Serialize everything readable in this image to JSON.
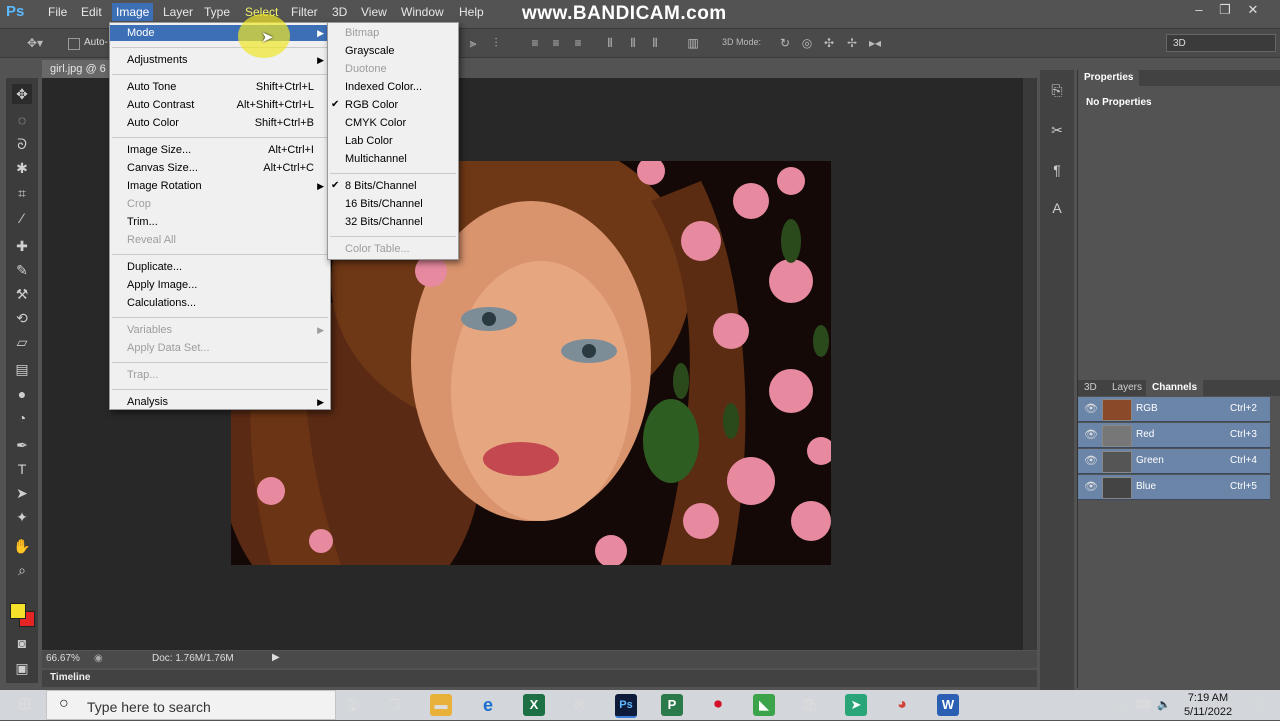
{
  "app": {
    "logo": "Ps",
    "menus": [
      "File",
      "Edit",
      "Image",
      "Layer",
      "Type",
      "Select",
      "Filter",
      "3D",
      "View",
      "Window",
      "Help"
    ],
    "watermark": "www.BANDICAM.com",
    "window_buttons": [
      "–",
      "❐",
      "✕"
    ]
  },
  "options_bar": {
    "auto_select_label": "Auto-",
    "three_d_mode_label": "3D Mode:",
    "workspace_select": "3D"
  },
  "document": {
    "tab_title": "girl.jpg @ 6",
    "zoom": "66.67%",
    "doc_info": "Doc: 1.76M/1.76M"
  },
  "timeline": {
    "label": "Timeline"
  },
  "image_menu": [
    {
      "label": "Mode",
      "submenu": true,
      "highlight": true
    },
    {
      "sep": true
    },
    {
      "label": "Adjustments",
      "submenu": true
    },
    {
      "sep": true
    },
    {
      "label": "Auto Tone",
      "shortcut": "Shift+Ctrl+L"
    },
    {
      "label": "Auto Contrast",
      "shortcut": "Alt+Shift+Ctrl+L"
    },
    {
      "label": "Auto Color",
      "shortcut": "Shift+Ctrl+B"
    },
    {
      "sep": true
    },
    {
      "label": "Image Size...",
      "shortcut": "Alt+Ctrl+I"
    },
    {
      "label": "Canvas Size...",
      "shortcut": "Alt+Ctrl+C"
    },
    {
      "label": "Image Rotation",
      "submenu": true
    },
    {
      "label": "Crop",
      "disabled": true
    },
    {
      "label": "Trim..."
    },
    {
      "label": "Reveal All",
      "disabled": true
    },
    {
      "sep": true
    },
    {
      "label": "Duplicate..."
    },
    {
      "label": "Apply Image..."
    },
    {
      "label": "Calculations..."
    },
    {
      "sep": true
    },
    {
      "label": "Variables",
      "submenu": true,
      "disabled": true
    },
    {
      "label": "Apply Data Set...",
      "disabled": true
    },
    {
      "sep": true
    },
    {
      "label": "Trap...",
      "disabled": true
    },
    {
      "sep": true
    },
    {
      "label": "Analysis",
      "submenu": true
    }
  ],
  "mode_menu": [
    {
      "label": "Bitmap",
      "disabled": true
    },
    {
      "label": "Grayscale"
    },
    {
      "label": "Duotone",
      "disabled": true
    },
    {
      "label": "Indexed Color..."
    },
    {
      "label": "RGB Color",
      "checked": true
    },
    {
      "label": "CMYK Color"
    },
    {
      "label": "Lab Color"
    },
    {
      "label": "Multichannel"
    },
    {
      "sep": true
    },
    {
      "label": "8 Bits/Channel",
      "checked": true
    },
    {
      "label": "16 Bits/Channel"
    },
    {
      "label": "32 Bits/Channel"
    },
    {
      "sep": true
    },
    {
      "label": "Color Table...",
      "disabled": true
    }
  ],
  "properties_panel": {
    "tab": "Properties",
    "empty_text": "No Properties"
  },
  "layers_panel": {
    "tabs": [
      "3D",
      "Layers",
      "Channels"
    ],
    "channels": [
      {
        "name": "RGB",
        "shortcut": "Ctrl+2"
      },
      {
        "name": "Red",
        "shortcut": "Ctrl+3"
      },
      {
        "name": "Green",
        "shortcut": "Ctrl+4"
      },
      {
        "name": "Blue",
        "shortcut": "Ctrl+5"
      }
    ]
  },
  "taskbar": {
    "search_placeholder": "Type here to search",
    "time": "7:19 AM",
    "date": "5/11/2022"
  },
  "colors": {
    "menu_highlight": "#3d6fb6",
    "foreground_color": "#f5e12a",
    "background_color": "#e52424"
  }
}
